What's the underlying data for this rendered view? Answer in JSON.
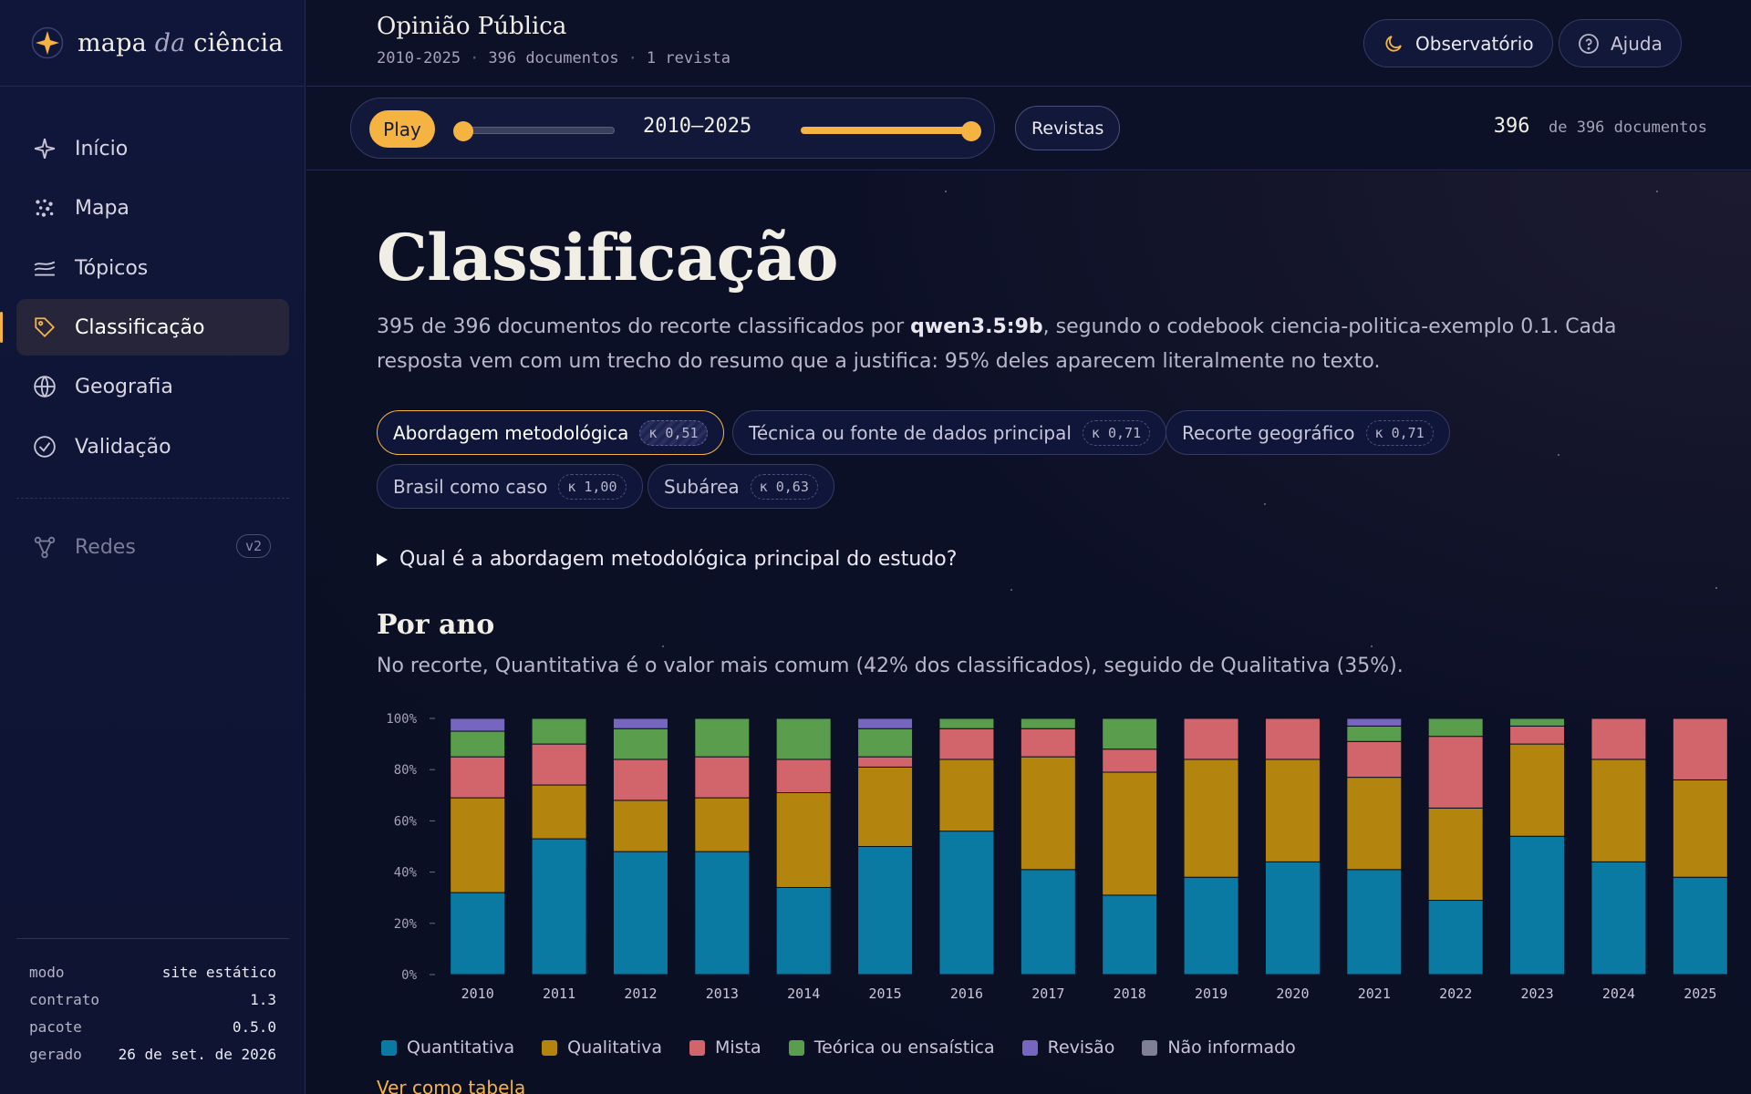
{
  "brand": {
    "prefix": "mapa",
    "middle": "da",
    "suffix": "ciência"
  },
  "nav": [
    {
      "label": "Início",
      "icon": "sparkle-icon",
      "active": false
    },
    {
      "label": "Mapa",
      "icon": "scatter-icon",
      "active": false
    },
    {
      "label": "Tópicos",
      "icon": "layers-icon",
      "active": false
    },
    {
      "label": "Classificação",
      "icon": "tag-icon",
      "active": true
    },
    {
      "label": "Geografia",
      "icon": "globe-icon",
      "active": false
    },
    {
      "label": "Validação",
      "icon": "check-circle-icon",
      "active": false
    },
    {
      "label": "Redes",
      "icon": "network-icon",
      "badge": "v2",
      "disabled": true
    }
  ],
  "meta": [
    {
      "k": "modo",
      "v": "site estático"
    },
    {
      "k": "contrato",
      "v": "1.3"
    },
    {
      "k": "pacote",
      "v": "0.5.0"
    },
    {
      "k": "gerado",
      "v": "26 de set. de 2026"
    }
  ],
  "header": {
    "title": "Opinião Pública",
    "sub": [
      "2010-2025",
      "396 documentos",
      "1 revista"
    ],
    "observatorio": "Observatório",
    "ajuda": "Ajuda"
  },
  "toolbar": {
    "play": "Play",
    "range": "2010–2025",
    "revistas": "Revistas",
    "count_big": "396",
    "count_rest": "de 396 documentos"
  },
  "main": {
    "title": "Classificação",
    "intro_a": "395 de 396 documentos do recorte classificados por ",
    "intro_model": "qwen3.5:9b",
    "intro_b": ", segundo o codebook ciencia-politica-exemplo 0.1. Cada resposta vem com um trecho do resumo que a justifica: 95% deles aparecem literalmente no texto.",
    "chips": [
      {
        "label": "Abordagem metodológica",
        "kappa": "κ 0,51",
        "active": true
      },
      {
        "label": "Técnica ou fonte de dados principal",
        "kappa": "κ 0,71"
      },
      {
        "label": "Recorte geográfico",
        "kappa": "κ 0,71"
      },
      {
        "label": "Brasil como caso",
        "kappa": "κ 1,00"
      },
      {
        "label": "Subárea",
        "kappa": "κ 0,63"
      }
    ],
    "question": "Qual é a abordagem metodológica principal do estudo?",
    "section_title": "Por ano",
    "section_summary": "No recorte, Quantitativa é o valor mais comum (42% dos classificados), seguido de Qualitativa (35%).",
    "table_link": "Ver como tabela"
  },
  "colors": {
    "accent": "#f5b342",
    "Quantitativa": "#0a7aa3",
    "Qualitativa": "#b3850f",
    "Mista": "#d2656c",
    "Teórica ou ensaística": "#5a9d4c",
    "Revisão": "#7766c0",
    "Não informado": "#7f7f98"
  },
  "chart_data": {
    "type": "bar",
    "stacked": true,
    "normalized": true,
    "categories": [
      "2010",
      "2011",
      "2012",
      "2013",
      "2014",
      "2015",
      "2016",
      "2017",
      "2018",
      "2019",
      "2020",
      "2021",
      "2022",
      "2023",
      "2024",
      "2025"
    ],
    "ylim": [
      0,
      100
    ],
    "yticks": [
      "0%",
      "20%",
      "40%",
      "60%",
      "80%",
      "100%"
    ],
    "series": [
      {
        "name": "Quantitativa",
        "values": [
          32,
          53,
          48,
          48,
          34,
          50,
          56,
          41,
          31,
          38,
          44,
          41,
          29,
          54,
          44,
          38
        ]
      },
      {
        "name": "Qualitativa",
        "values": [
          37,
          21,
          20,
          21,
          37,
          31,
          28,
          44,
          48,
          46,
          40,
          36,
          36,
          36,
          40,
          38
        ]
      },
      {
        "name": "Mista",
        "values": [
          16,
          16,
          16,
          16,
          13,
          4,
          12,
          11,
          9,
          16,
          16,
          14,
          28,
          7,
          16,
          24
        ]
      },
      {
        "name": "Teórica ou ensaística",
        "values": [
          10,
          10,
          12,
          15,
          16,
          11,
          4,
          4,
          12,
          0,
          0,
          6,
          7,
          3,
          0,
          0
        ]
      },
      {
        "name": "Revisão",
        "values": [
          5,
          0,
          4,
          0,
          0,
          4,
          0,
          0,
          0,
          0,
          0,
          3,
          0,
          0,
          0,
          0
        ]
      },
      {
        "name": "Não informado",
        "values": [
          0,
          0,
          0,
          0,
          0,
          0,
          0,
          0,
          0,
          0,
          0,
          0,
          0,
          0,
          0,
          0
        ]
      }
    ]
  }
}
